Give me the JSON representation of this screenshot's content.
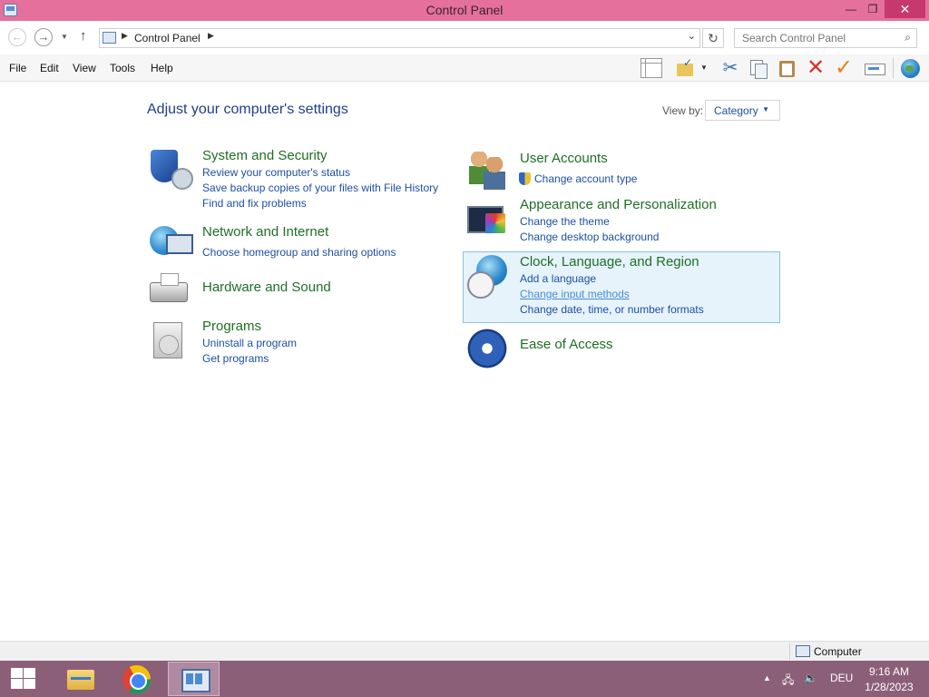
{
  "window": {
    "title": "Control Panel"
  },
  "address_bar": {
    "crumb": "Control Panel",
    "search_placeholder": "Search Control Panel"
  },
  "menu": [
    "File",
    "Edit",
    "View",
    "Tools",
    "Help"
  ],
  "main": {
    "heading": "Adjust your computer's settings",
    "view_by": {
      "label": "View by:",
      "value": "Category"
    },
    "categories_left": [
      {
        "title": "System and Security",
        "links": [
          "Review your computer's status",
          "Save backup copies of your files with File History",
          "Find and fix problems"
        ]
      },
      {
        "title": "Network and Internet",
        "links": [
          "Choose homegroup and sharing options"
        ]
      },
      {
        "title": "Hardware and Sound",
        "links": []
      },
      {
        "title": "Programs",
        "links": [
          "Uninstall a program",
          "Get programs"
        ]
      }
    ],
    "categories_right": [
      {
        "title": "User Accounts",
        "links": [
          "Change account type"
        ]
      },
      {
        "title": "Appearance and Personalization",
        "links": [
          "Change the theme",
          "Change desktop background"
        ]
      },
      {
        "title": "Clock, Language, and Region",
        "links": [
          "Add a language",
          "Change input methods",
          "Change date, time, or number formats"
        ]
      },
      {
        "title": "Ease of Access",
        "links": []
      }
    ]
  },
  "status_bar": {
    "label": "Computer"
  },
  "taskbar": {
    "language": "DEU",
    "time": "9:16 AM",
    "date": "1/28/2023"
  },
  "colors": {
    "title_bar": "#e5709b",
    "taskbar": "#8c5f78",
    "category_title": "#1f6e26",
    "link": "#1e4fa4",
    "heading": "#1e3f88"
  }
}
